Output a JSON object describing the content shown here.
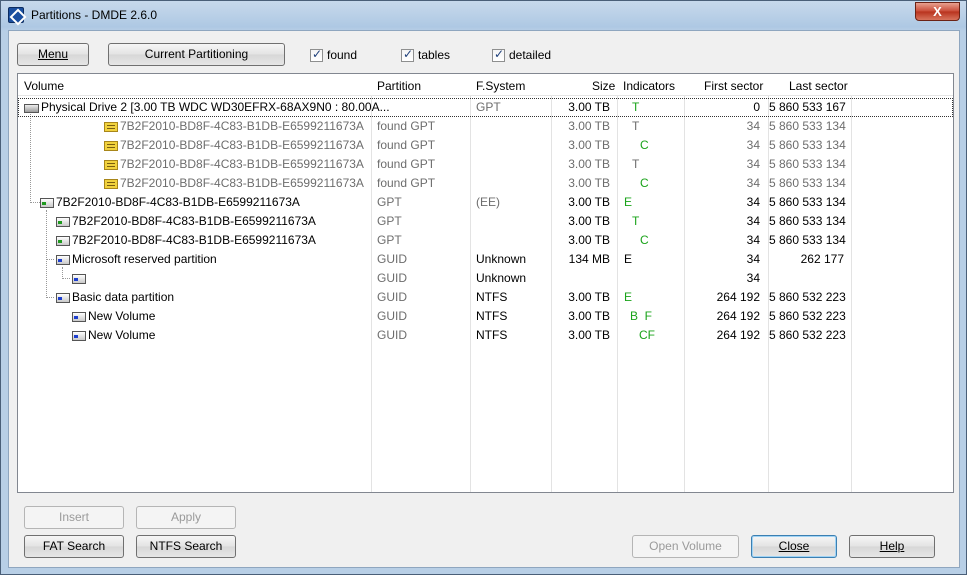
{
  "window": {
    "title": "Partitions - DMDE 2.6.0",
    "close_label": "X"
  },
  "toolbar": {
    "menu_label": "Menu",
    "current_partitioning_label": "Current Partitioning",
    "found_label": "found",
    "tables_label": "tables",
    "detailed_label": "detailed"
  },
  "table": {
    "columns": [
      "Volume",
      "Partition",
      "F.System",
      "Size",
      "Indicators",
      "First sector",
      "Last sector"
    ],
    "rows": [
      {
        "volume": "Physical Drive 2 [3.00 TB WDC WD30EFRX-68AX9N0 : 80.00A...",
        "partition": "",
        "fs": "GPT",
        "size": "3.00 TB",
        "indicators": "T",
        "first": "0",
        "last": "5 860 533 167"
      },
      {
        "volume": "7B2F2010-BD8F-4C83-B1DB-E6599211673A",
        "partition": "found GPT",
        "fs": "",
        "size": "3.00 TB",
        "indicators": "T",
        "first": "34",
        "last": "5 860 533 134"
      },
      {
        "volume": "7B2F2010-BD8F-4C83-B1DB-E6599211673A",
        "partition": "found GPT",
        "fs": "",
        "size": "3.00 TB",
        "indicators": "C",
        "first": "34",
        "last": "5 860 533 134"
      },
      {
        "volume": "7B2F2010-BD8F-4C83-B1DB-E6599211673A",
        "partition": "found GPT",
        "fs": "",
        "size": "3.00 TB",
        "indicators": "T",
        "first": "34",
        "last": "5 860 533 134"
      },
      {
        "volume": "7B2F2010-BD8F-4C83-B1DB-E6599211673A",
        "partition": "found GPT",
        "fs": "",
        "size": "3.00 TB",
        "indicators": "C",
        "first": "34",
        "last": "5 860 533 134"
      },
      {
        "volume": "7B2F2010-BD8F-4C83-B1DB-E6599211673A",
        "partition": "GPT",
        "fs": "(EE)",
        "size": "3.00 TB",
        "indicators": "E",
        "first": "34",
        "last": "5 860 533 134"
      },
      {
        "volume": "7B2F2010-BD8F-4C83-B1DB-E6599211673A",
        "partition": "GPT",
        "fs": "",
        "size": "3.00 TB",
        "indicators": "T",
        "first": "34",
        "last": "5 860 533 134"
      },
      {
        "volume": "7B2F2010-BD8F-4C83-B1DB-E6599211673A",
        "partition": "GPT",
        "fs": "",
        "size": "3.00 TB",
        "indicators": "C",
        "first": "34",
        "last": "5 860 533 134"
      },
      {
        "volume": "Microsoft reserved partition",
        "partition": "GUID",
        "fs": "Unknown",
        "size": "134 MB",
        "indicators": "E",
        "first": "34",
        "last": "262 177"
      },
      {
        "volume": "",
        "partition": "GUID",
        "fs": "Unknown",
        "size": "",
        "indicators": "",
        "first": "34",
        "last": ""
      },
      {
        "volume": "Basic data partition",
        "partition": "GUID",
        "fs": "NTFS",
        "size": "3.00 TB",
        "indicators": "E",
        "first": "264 192",
        "last": "5 860 532 223"
      },
      {
        "volume": "New Volume",
        "partition": "GUID",
        "fs": "NTFS",
        "size": "3.00 TB",
        "indicators": "B  F",
        "first": "264 192",
        "last": "5 860 532 223"
      },
      {
        "volume": "New Volume",
        "partition": "GUID",
        "fs": "NTFS",
        "size": "3.00 TB",
        "indicators": "CF",
        "first": "264 192",
        "last": "5 860 532 223"
      }
    ]
  },
  "buttons": {
    "insert": "Insert",
    "apply": "Apply",
    "fat_search": "FAT Search",
    "ntfs_search": "NTFS Search",
    "open_volume": "Open Volume",
    "close": "Close",
    "help": "Help"
  },
  "colors": {
    "indicator": "#1aa31a",
    "found_text": "#6d6d6d"
  },
  "icons": {
    "app": "dmde-app-icon",
    "drive": "hard-drive-icon",
    "found_table": "found-table-icon",
    "partition_green": "partition-green-icon",
    "partition_blue": "partition-blue-icon",
    "partition_unknown": "partition-unknown-icon"
  }
}
